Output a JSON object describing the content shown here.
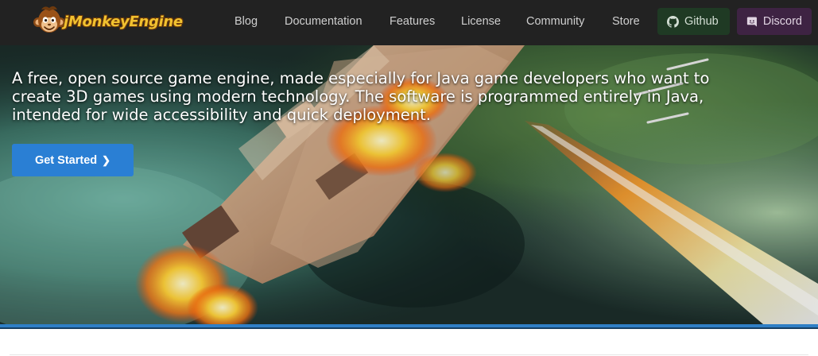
{
  "navbar": {
    "brand_name": "jMonkeyEngine",
    "links": [
      {
        "label": "Blog"
      },
      {
        "label": "Documentation"
      },
      {
        "label": "Features"
      },
      {
        "label": "License"
      },
      {
        "label": "Community"
      },
      {
        "label": "Store"
      }
    ],
    "github_label": "Github",
    "discord_label": "Discord",
    "icons": {
      "logo": "monkey-logo-icon",
      "github": "github-icon",
      "discord": "discord-icon"
    },
    "colors": {
      "background": "#222222",
      "github_button": "#1f3a24",
      "discord_button": "#3e2343",
      "brand_text": "#f2c230"
    }
  },
  "hero": {
    "tagline": "A free, open source game engine, made especially for Java game developers who want to create 3D games using modern technology. The software is programmed entirely in Java, intended for wide accessibility and quick deployment.",
    "cta_label": "Get Started",
    "cta_icon": "chevron-right-icon",
    "colors": {
      "cta": "#2a7fd4",
      "stripe": "#2f7fc6"
    }
  }
}
